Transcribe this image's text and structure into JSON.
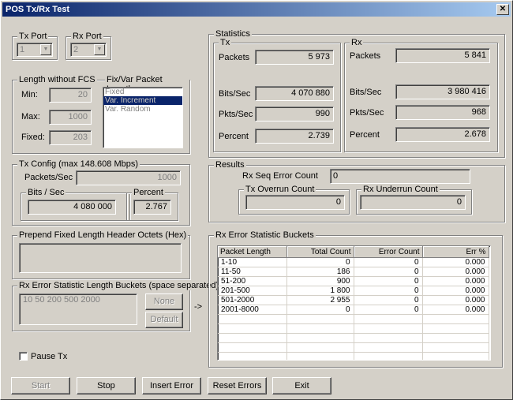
{
  "window": {
    "title": "POS Tx/Rx Test",
    "close_label": "✕"
  },
  "tx_port": {
    "label": "Tx Port",
    "value": "1"
  },
  "rx_port": {
    "label": "Rx Port",
    "value": "2"
  },
  "length": {
    "label": "Length without FCS",
    "min_label": "Min:",
    "min_value": "20",
    "max_label": "Max:",
    "max_value": "1000",
    "fixed_label": "Fixed:",
    "fixed_value": "203"
  },
  "fixvar": {
    "label": "Fix/Var Packet Length",
    "options": [
      "Fixed",
      "Var. Increment",
      "Var. Random"
    ],
    "selected_index": 1
  },
  "statistics": {
    "label": "Statistics",
    "tx": {
      "label": "Tx",
      "packets_label": "Packets",
      "packets": "5 973",
      "bits_label": "Bits/Sec",
      "bits": "4 070 880",
      "pkts_label": "Pkts/Sec",
      "pkts": "990",
      "percent_label": "Percent",
      "percent": "2.739"
    },
    "rx": {
      "label": "Rx",
      "packets_label": "Packets",
      "packets": "5 841",
      "bits_label": "Bits/Sec",
      "bits": "3 980 416",
      "pkts_label": "Pkts/Sec",
      "pkts": "968",
      "percent_label": "Percent",
      "percent": "2.678"
    }
  },
  "tx_config": {
    "label": "Tx Config (max 148.608 Mbps)",
    "packets_label": "Packets/Sec",
    "packets_value": "1000",
    "bits_label": "Bits / Sec",
    "bits_value": "4 080 000",
    "percent_label": "Percent",
    "percent_value": "2.767"
  },
  "results": {
    "label": "Results",
    "seq_label": "Rx Seq Error Count",
    "seq_value": "0",
    "overrun_label": "Tx Overrun Count",
    "overrun_value": "0",
    "underrun_label": "Rx Underrun Count",
    "underrun_value": "0"
  },
  "prepend": {
    "label": "Prepend Fixed Length Header Octets (Hex)",
    "value": ""
  },
  "buckets_cfg": {
    "label": "Rx Error Statistic Length Buckets (space separated)",
    "value": "10 50 200 500 2000",
    "none_label": "None",
    "default_label": "Default",
    "arrow": "->"
  },
  "buckets_table": {
    "label": "Rx Error Statistic Buckets",
    "headers": [
      "Packet Length",
      "Total Count",
      "Error Count",
      "Err %"
    ],
    "rows": [
      [
        "1-10",
        "0",
        "0",
        "0.000"
      ],
      [
        "11-50",
        "186",
        "0",
        "0.000"
      ],
      [
        "51-200",
        "900",
        "0",
        "0.000"
      ],
      [
        "201-500",
        "1 800",
        "0",
        "0.000"
      ],
      [
        "501-2000",
        "2 955",
        "0",
        "0.000"
      ],
      [
        "2001-8000",
        "0",
        "0",
        "0.000"
      ]
    ]
  },
  "pause_tx": {
    "label": "Pause Tx",
    "checked": false
  },
  "buttons": {
    "start": "Start",
    "stop": "Stop",
    "insert_error": "Insert Error",
    "reset_errors": "Reset Errors",
    "exit": "Exit"
  }
}
